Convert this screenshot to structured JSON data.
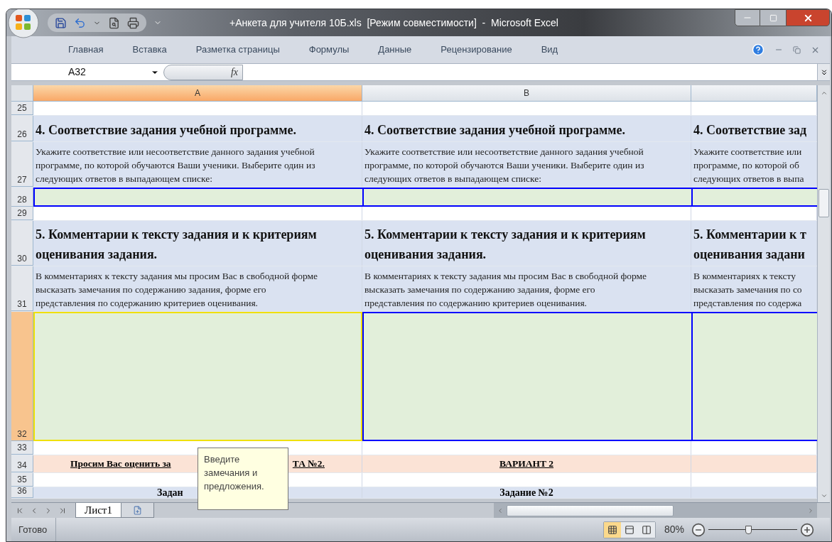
{
  "window": {
    "title": "+Анкета для учителя 10Б.xls  [Режим совместимости]  -  Microsoft Excel"
  },
  "ribbon_tabs": [
    "Главная",
    "Вставка",
    "Разметка страницы",
    "Формулы",
    "Данные",
    "Рецензирование",
    "Вид"
  ],
  "formula_bar": {
    "name_box": "A32",
    "fx": "fx"
  },
  "columns": [
    {
      "label": "A",
      "selected": true
    },
    {
      "label": "B",
      "selected": false
    },
    {
      "selected": false
    }
  ],
  "rows": [
    {
      "number": "25",
      "kind": "blank",
      "selected": false,
      "cells": [
        {},
        {},
        {}
      ]
    },
    {
      "number": "26",
      "kind": "heading",
      "selected": false,
      "cells": [
        {
          "lines": [
            "4. Соответствие задания учебной программе."
          ]
        },
        {
          "lines": [
            "4. Соответствие задания учебной программе."
          ]
        },
        {
          "lines": [
            "4. Соответствие зад"
          ]
        }
      ]
    },
    {
      "number": "27",
      "kind": "note",
      "selected": false,
      "cells": [
        {
          "lines": [
            "Укажите соответствие или несоответствие данного задания учебной",
            "программе, по которой обучаются Ваши ученики. Выберите один из",
            "следующих ответов в выпадающем списке:"
          ]
        },
        {
          "lines": [
            "Укажите соответствие или несоответствие данного задания учебной",
            "программе, по которой обучаются Ваши ученики. Выберите один из",
            "следующих ответов в выпадающем списке:"
          ]
        },
        {
          "lines": [
            "Укажите соответствие или",
            "программе, по которой об",
            "следующих ответов в выпа"
          ]
        }
      ]
    },
    {
      "number": "28",
      "kind": "choice_input",
      "selected": false,
      "cells": [
        {
          "selected": false
        },
        {
          "selected": false
        },
        {
          "selected": false
        }
      ]
    },
    {
      "number": "29",
      "kind": "blank",
      "selected": false,
      "cells": [
        {},
        {},
        {}
      ]
    },
    {
      "number": "30",
      "kind": "heading",
      "selected": false,
      "cells": [
        {
          "lines": [
            "5. Комментарии к тексту задания и к критериям",
            "оценивания задания."
          ]
        },
        {
          "lines": [
            "5. Комментарии к тексту задания и к критериям",
            "оценивания задания."
          ]
        },
        {
          "lines": [
            "5. Комментарии к т",
            "оценивания задани"
          ]
        }
      ]
    },
    {
      "number": "31",
      "kind": "note",
      "selected": false,
      "cells": [
        {
          "lines": [
            "В комментариях к тексту задания мы просим Вас в свободной форме",
            "высказать замечания по содержанию задания, форме его",
            "представления по содержанию критериев оценивания."
          ]
        },
        {
          "lines": [
            "В комментариях к тексту задания мы просим Вас в свободной форме",
            "высказать замечания по содержанию задания, форме его",
            "представления по содержанию критериев оценивания."
          ]
        },
        {
          "lines": [
            "В комментариях к тексту",
            "высказать замечания по со",
            "представления по содержа"
          ]
        }
      ]
    },
    {
      "number": "32",
      "kind": "comment_input",
      "selected": true,
      "cells": [
        {
          "selected": true
        },
        {
          "selected": false
        },
        {
          "selected": false
        }
      ]
    },
    {
      "number": "33",
      "kind": "blank",
      "selected": false,
      "cells": [
        {},
        {},
        {}
      ]
    },
    {
      "number": "34",
      "kind": "banner",
      "selected": false,
      "cells": [
        {
          "lines": [
            "Просим Вас оценить за",
            "ТА №2."
          ]
        },
        {
          "lines": [
            "ВАРИАНТ 2"
          ]
        },
        {}
      ]
    },
    {
      "number": "35",
      "kind": "blank",
      "selected": false,
      "cells": [
        {},
        {},
        {}
      ]
    },
    {
      "number": "36",
      "kind": "title",
      "selected": false,
      "cells": [
        {
          "lines": [
            "Задан"
          ]
        },
        {
          "lines": [
            "Задание №2"
          ]
        },
        {}
      ]
    }
  ],
  "tooltip": {
    "text": "Введите замечания и предложения."
  },
  "sheet_tabs": [
    {
      "label": "Лист1",
      "selected": true
    }
  ],
  "status_bar": {
    "status": "Готово",
    "zoom": "80%",
    "zoom_slider": {
      "level": 0.45
    },
    "views": [
      {
        "kind": "normal",
        "selected": true
      },
      {
        "kind": "layout",
        "selected": false
      },
      {
        "kind": "pagebreak",
        "selected": false
      }
    ]
  }
}
